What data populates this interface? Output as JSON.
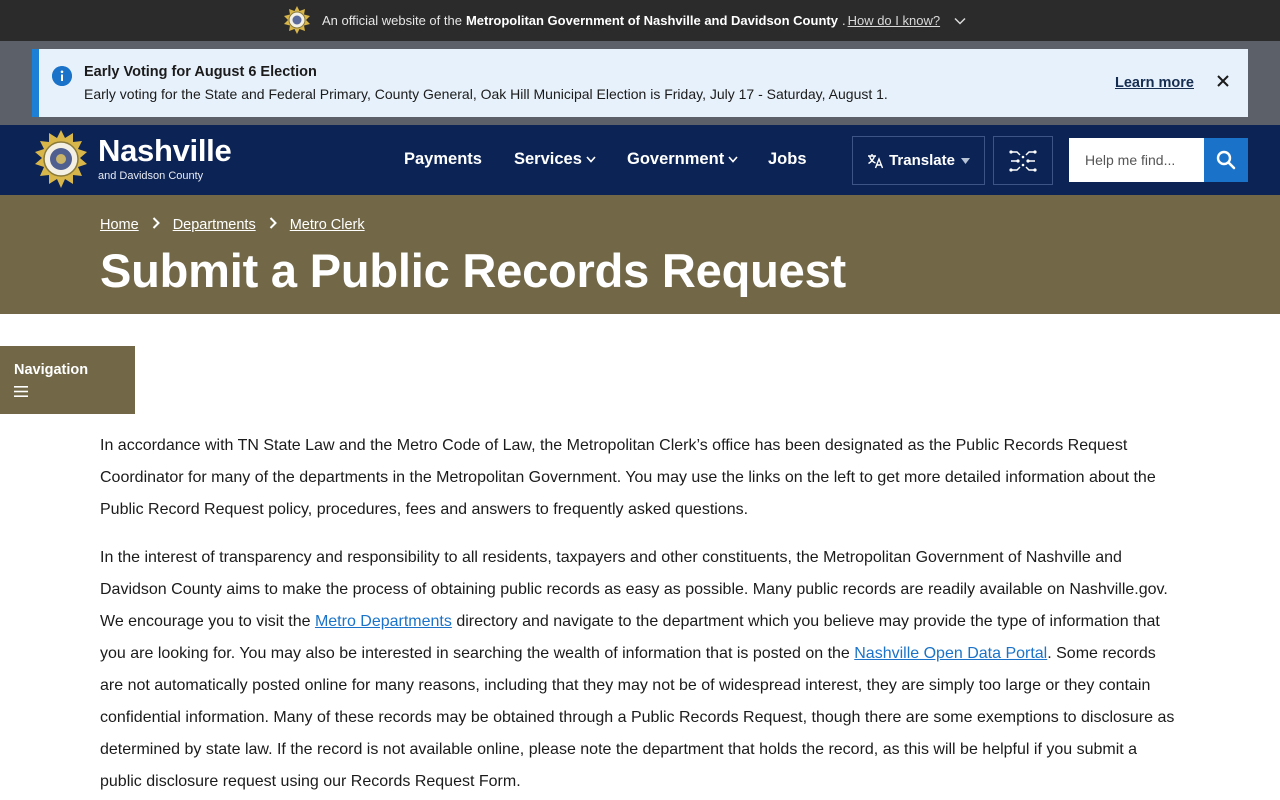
{
  "official_banner": {
    "prefix": "An official website of the",
    "org": "Metropolitan Government of Nashville and Davidson County",
    "period": ".",
    "how_link": "How do I know?"
  },
  "alert": {
    "title": "Early Voting for August 6 Election",
    "text": "Early voting for the State and Federal Primary, County General, Oak Hill Municipal Election is Friday, July 17 - Saturday, August 1.",
    "learn_more": "Learn more"
  },
  "header": {
    "logo_name": "Nashville",
    "logo_sub": "and Davidson County",
    "nav": {
      "payments": "Payments",
      "services": "Services",
      "government": "Government",
      "jobs": "Jobs"
    },
    "translate": "Translate",
    "search_placeholder": "Help me find..."
  },
  "hero": {
    "breadcrumb": [
      "Home",
      "Departments",
      "Metro Clerk"
    ],
    "title": "Submit a Public Records Request"
  },
  "sidebar": {
    "toggle_label": "Navigation"
  },
  "content": {
    "p1": "In accordance with TN State Law and the Metro Code of Law, the Metropolitan Clerk’s office has been designated as the Public Records Request Coordinator for many of the departments in the Metropolitan Government. You may use the links on the left to get more detailed information about the Public Record Request policy, procedures, fees and answers to frequently asked questions.",
    "p2_a": "In the interest of transparency and responsibility to all residents, taxpayers and other constituents, the Metropolitan Government of Nashville and Davidson County aims to make the process of obtaining public records as easy as possible. Many public records are readily available on Nashville.gov. We encourage you to visit the ",
    "p2_link1": "Metro Departments",
    "p2_b": " directory and navigate to the department which you believe may provide the type of information that you are looking for. You may also be interested in searching the wealth of information that is posted on the ",
    "p2_link2": "Nashville Open Data Portal",
    "p2_c": ". Some records are not automatically posted online for many reasons, including that they may not be of widespread interest, they are simply too large or they contain confidential information. Many of these records may be obtained through a Public Records Request, though there are some exemptions to disclosure as determined by state law. If the record is not available online, please note the department that holds the record, as this will be helpful if you submit a public disclosure request using our Records Request Form."
  },
  "colors": {
    "official_bar": "#2b2b2b",
    "header_navy": "#0c2356",
    "hero_olive": "#726848",
    "accent_blue": "#1a73c8",
    "alert_bg": "#e7f1fb"
  },
  "icons": [
    "seal-icon",
    "chevron-down-icon",
    "info-icon",
    "close-icon",
    "translate-icon",
    "caret-down-icon",
    "ai-chip-icon",
    "search-icon",
    "chevron-right-icon",
    "menu-icon"
  ]
}
